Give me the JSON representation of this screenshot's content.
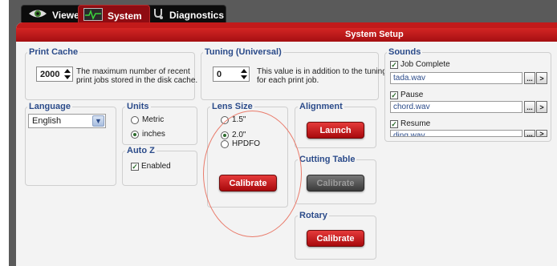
{
  "tabs": [
    {
      "label": "Viewer",
      "icon": "eye-icon",
      "active": false
    },
    {
      "label": "System",
      "icon": "pulse-monitor-icon",
      "active": true
    },
    {
      "label": "Diagnostics",
      "icon": "stethoscope-icon",
      "active": false
    }
  ],
  "header": {
    "title": "System Setup"
  },
  "print_cache": {
    "title": "Print Cache",
    "value": "2000",
    "note_line1": "The maximum number of recent",
    "note_line2": "print jobs stored in the disk cache."
  },
  "tuning": {
    "title": "Tuning (Universal)",
    "value": "0",
    "note_line1": "This value is in addition to the tuning",
    "note_line2": "for each print job."
  },
  "language": {
    "title": "Language",
    "selected": "English"
  },
  "units": {
    "title": "Units",
    "options": [
      "Metric",
      "inches"
    ],
    "selected": "inches"
  },
  "autoz": {
    "title": "Auto Z",
    "enabled_label": "Enabled",
    "enabled": true
  },
  "lens_size": {
    "title": "Lens Size",
    "options": [
      "1.5\"",
      "2.0\"",
      "HPDFO"
    ],
    "selected": "2.0\"",
    "calibrate_label": "Calibrate"
  },
  "alignment": {
    "title": "Alignment",
    "launch_label": "Launch"
  },
  "cutting_table": {
    "title": "Cutting Table",
    "calibrate_label": "Calibrate",
    "enabled": false
  },
  "rotary": {
    "title": "Rotary",
    "calibrate_label": "Calibrate"
  },
  "sounds": {
    "title": "Sounds",
    "items": [
      {
        "label": "Job Complete",
        "checked": true,
        "file": "tada.wav"
      },
      {
        "label": "Pause",
        "checked": true,
        "file": "chord.wav"
      },
      {
        "label": "Resume",
        "checked": true,
        "file": "ding.wav"
      }
    ],
    "browse_label": "...",
    "play_label": ">"
  },
  "colors": {
    "accent_red": "#c21a1a",
    "group_title": "#2b4b8a",
    "annotation": "#e97a6a"
  }
}
